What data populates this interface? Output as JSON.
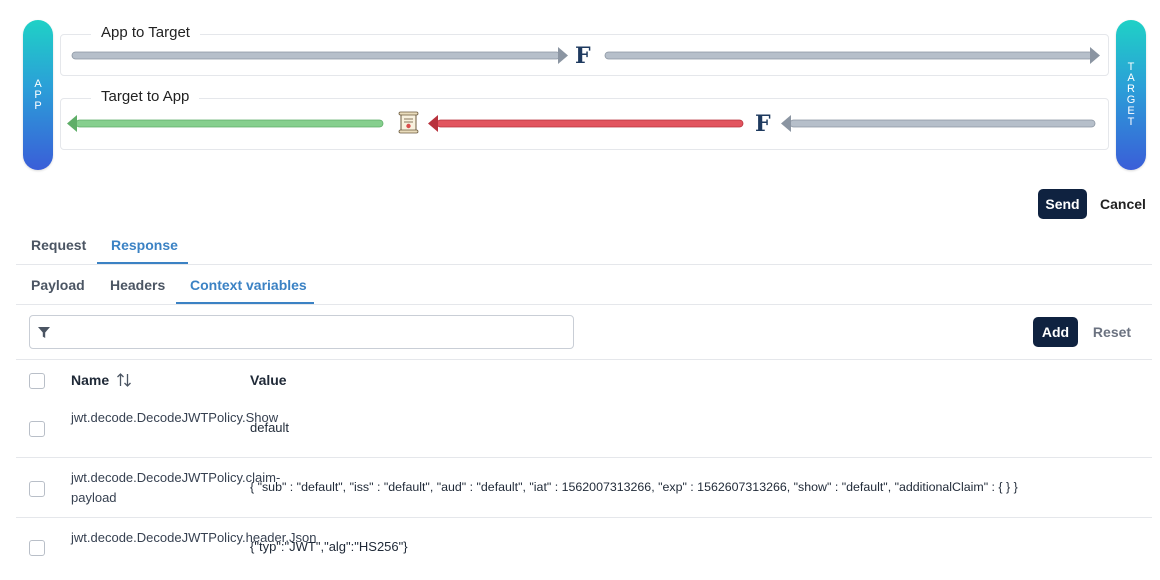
{
  "flow": {
    "app_pill": [
      "A",
      "P",
      "P"
    ],
    "target_pill": [
      "T",
      "A",
      "R",
      "G",
      "E",
      "T"
    ],
    "app_to_target": {
      "label": "App to Target",
      "policy_icon": "F"
    },
    "target_to_app": {
      "label": "Target to App",
      "policy_icon": "F"
    }
  },
  "actions": {
    "send": "Send",
    "cancel": "Cancel"
  },
  "main_tabs": [
    {
      "label": "Request"
    },
    {
      "label": "Response",
      "active": true
    }
  ],
  "sub_tabs": [
    {
      "label": "Payload"
    },
    {
      "label": "Headers"
    },
    {
      "label": "Context variables",
      "active": true
    }
  ],
  "filter": {
    "placeholder": "",
    "value": ""
  },
  "table_actions": {
    "add": "Add",
    "reset": "Reset"
  },
  "table": {
    "columns": {
      "name": "Name",
      "value": "Value"
    },
    "rows": [
      {
        "name": "jwt.decode.DecodeJWTPolicy.Show",
        "value": "default"
      },
      {
        "name": "jwt.decode.DecodeJWTPolicy.claim-payload",
        "value": "{ \"sub\" : \"default\", \"iss\" : \"default\", \"aud\" : \"default\", \"iat\" : 1562007313266, \"exp\" : 1562607313266, \"show\" : \"default\", \"additionalClaim\" : { } }"
      },
      {
        "name": "jwt.decode.DecodeJWTPolicy.header.Json",
        "value": "{\"typ\":\"JWT\",\"alg\":\"HS256\"}"
      }
    ]
  },
  "colors": {
    "accent": "#3b82c4",
    "dark_button": "#0f2240",
    "arrow_gray": "#b6bfca",
    "arrow_green": "#86cf8e",
    "arrow_red": "#e2555f"
  },
  "icons": [
    "funnel-icon",
    "sort-icon",
    "policy-f-icon",
    "certificate-scroll-icon"
  ]
}
